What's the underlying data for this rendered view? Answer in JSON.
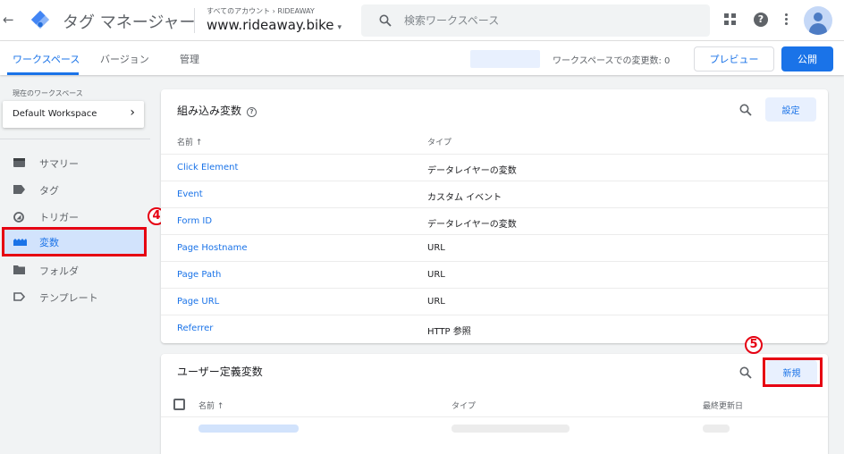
{
  "header": {
    "back_glyph": "←",
    "app_title": "タグ マネージャー",
    "account_path": "すべてのアカウント › RIDEAWAY",
    "container": "www.rideaway.bike",
    "caret": "▾",
    "search_placeholder": "検索ワークスペース",
    "help_glyph": "?"
  },
  "subnav": {
    "tabs": [
      "ワークスペース",
      "バージョン",
      "管理"
    ],
    "changes_text": "ワークスペースでの変更数: 0",
    "preview_label": "プレビュー",
    "publish_label": "公開"
  },
  "sidebar": {
    "workspace_caption": "現在のワークスペース",
    "workspace_name": "Default Workspace",
    "chevron": "›",
    "items": [
      {
        "label": "サマリー",
        "icon": "summary-icon"
      },
      {
        "label": "タグ",
        "icon": "tag-icon"
      },
      {
        "label": "トリガー",
        "icon": "trigger-icon"
      },
      {
        "label": "変数",
        "icon": "variables-icon",
        "active": true
      },
      {
        "label": "フォルダ",
        "icon": "folder-icon"
      },
      {
        "label": "テンプレート",
        "icon": "template-icon"
      }
    ]
  },
  "builtin": {
    "title": "組み込み変数",
    "help_glyph": "?",
    "configure_label": "設定",
    "col_name": "名前 ↑",
    "col_type": "タイプ",
    "rows": [
      {
        "name": "Click Element",
        "type": "データレイヤーの変数"
      },
      {
        "name": "Event",
        "type": "カスタム イベント"
      },
      {
        "name": "Form ID",
        "type": "データレイヤーの変数"
      },
      {
        "name": "Page Hostname",
        "type": "URL"
      },
      {
        "name": "Page Path",
        "type": "URL"
      },
      {
        "name": "Page URL",
        "type": "URL"
      },
      {
        "name": "Referrer",
        "type": "HTTP 参照"
      }
    ]
  },
  "user_defined": {
    "title": "ユーザー定義変数",
    "new_label": "新規",
    "col_name": "名前 ↑",
    "col_type": "タイプ",
    "col_updated": "最終更新日"
  },
  "annotations": {
    "step4": "4",
    "step5": "5",
    "highlight_color": "#e60012"
  },
  "colors": {
    "accent": "#1a73e8",
    "active_bg": "#d2e3fc",
    "background": "#f1f3f4"
  }
}
